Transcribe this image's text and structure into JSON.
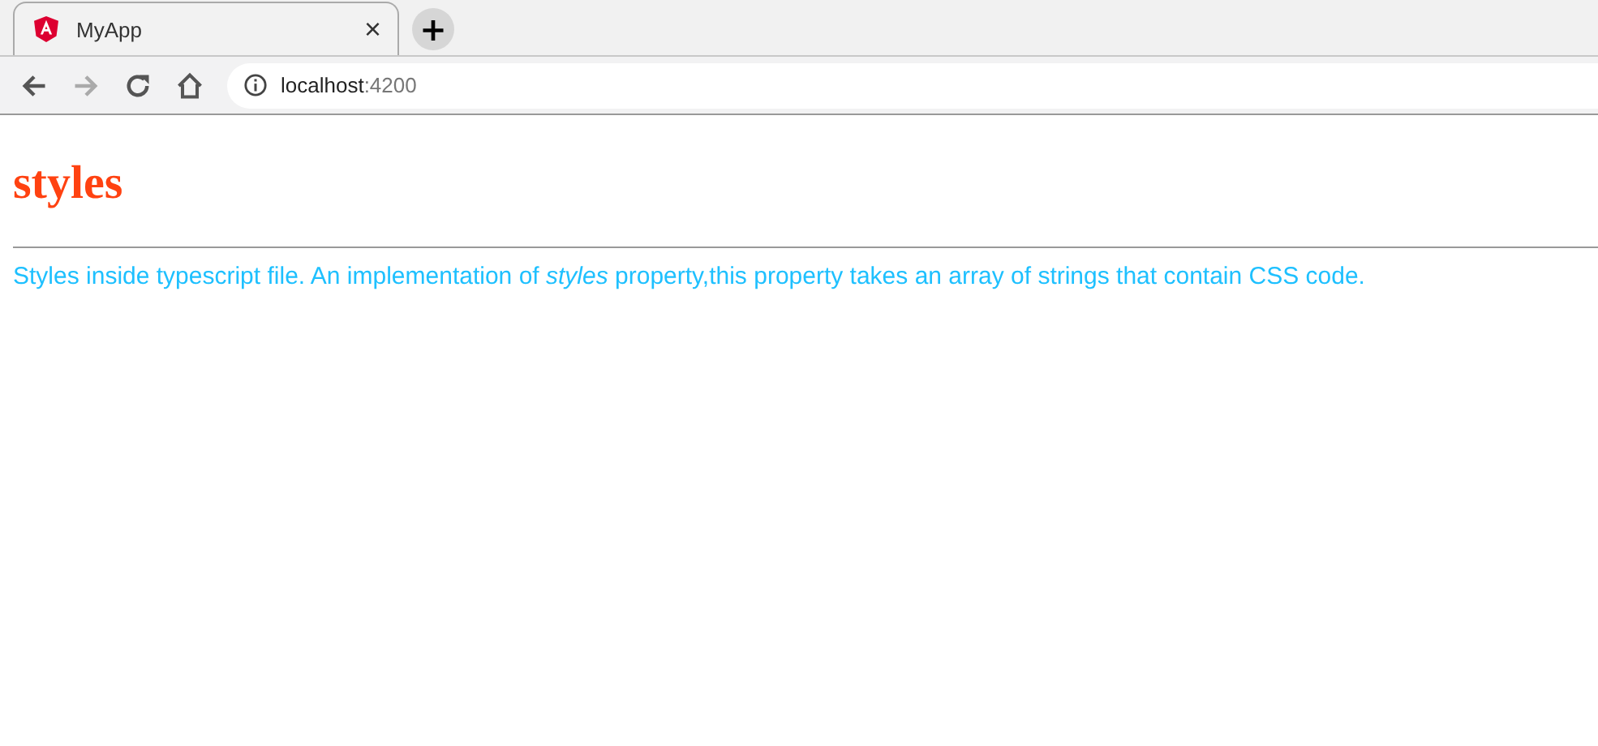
{
  "browser": {
    "tab": {
      "title": "MyApp",
      "close": "×",
      "selected": true
    },
    "new_tab": "+",
    "address": {
      "host": "localhost",
      "port": ":4200"
    },
    "forward_disabled": true
  },
  "page": {
    "heading": "styles",
    "paragraph": "Styles inside typescript file. An implementation of *styles* property,this property takes an array of strings that contain CSS code."
  }
}
